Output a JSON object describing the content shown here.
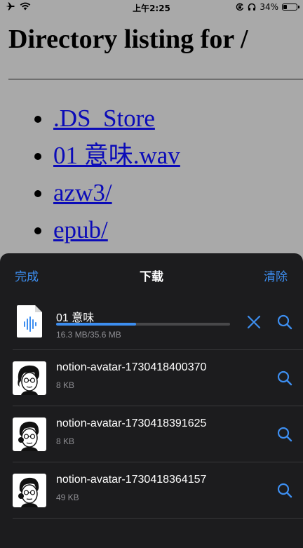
{
  "status_bar": {
    "time": "上午2:25",
    "battery_percent": "34%",
    "battery_level": 0.34
  },
  "page": {
    "title": "Directory listing for /",
    "items": [
      ".DS_Store",
      "01 意味.wav",
      "azw3/",
      "epub/"
    ]
  },
  "downloads_sheet": {
    "done_label": "完成",
    "title": "下载",
    "clear_label": "清除",
    "active": {
      "name": "01 意味",
      "size": "16.3 MB/35.6 MB",
      "progress": 0.458
    },
    "files": [
      {
        "name": "notion-avatar-1730418400370",
        "size": "8 KB"
      },
      {
        "name": "notion-avatar-1730418391625",
        "size": "8 KB"
      },
      {
        "name": "notion-avatar-1730418364157",
        "size": "49 KB"
      }
    ]
  },
  "colors": {
    "accent": "#3d8ef0",
    "sheet_background": "#1c1c1e",
    "page_background": "#a9a9a9",
    "link": "#0b0bb8"
  },
  "icons": [
    "airplane-icon",
    "wifi-icon",
    "orientation-lock-icon",
    "headphones-icon",
    "battery-icon",
    "audio-file-icon",
    "close-icon",
    "search-icon",
    "avatar-thumbnail"
  ]
}
